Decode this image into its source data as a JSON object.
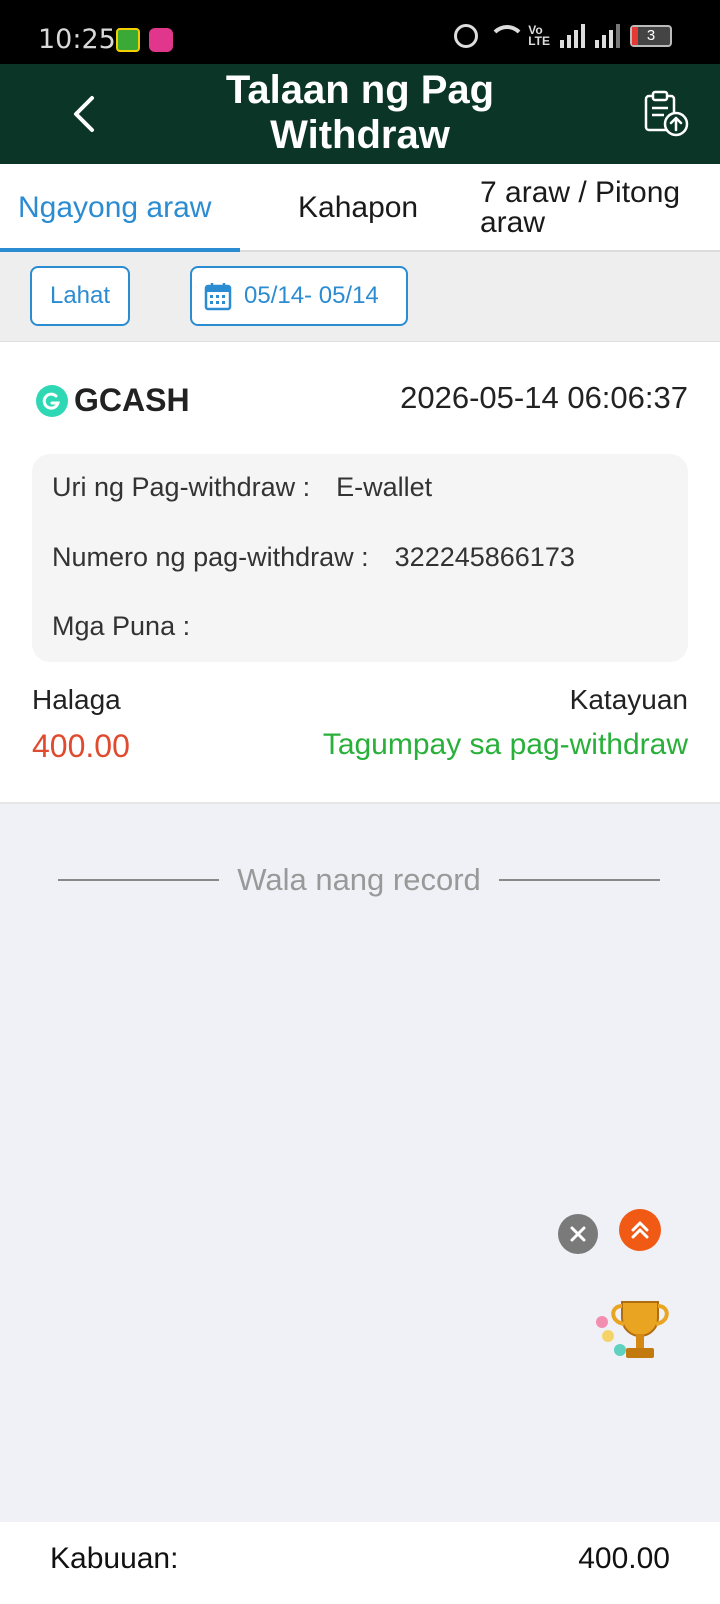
{
  "status_bar": {
    "time": "10:25",
    "battery": "3"
  },
  "header": {
    "title": "Talaan ng Pag Withdraw",
    "back_icon": "chevron-left-icon",
    "export_icon": "clipboard-upload-icon"
  },
  "tabs": [
    {
      "label": "Ngayong araw",
      "active": true
    },
    {
      "label": "Kahapon",
      "active": false
    },
    {
      "label": "7 araw / Pitong araw",
      "active": false
    }
  ],
  "filters": {
    "all_label": "Lahat",
    "date_range": "05/14- 05/14",
    "calendar_icon": "calendar-icon"
  },
  "record": {
    "method": "GCASH",
    "datetime": "2026-05-14 06:06:37",
    "details": {
      "type_label": "Uri ng Pag-withdraw :",
      "type_value": "E-wallet",
      "number_label": "Numero ng pag-withdraw :",
      "number_value": "322245866173",
      "remarks_label": "Mga Puna :",
      "remarks_value": ""
    },
    "amount_label": "Halaga",
    "amount_value": "400.00",
    "status_label": "Katayuan",
    "status_value": "Tagumpay sa pag-withdraw"
  },
  "list_end_text": "Wala nang record",
  "footer": {
    "total_label": "Kabuuan:",
    "total_value": "400.00"
  },
  "colors": {
    "header_bg": "#0b3526",
    "accent": "#2b8cd2",
    "amount": "#e04a2e",
    "success": "#28b03a",
    "gcash": "#2fd8b4"
  }
}
